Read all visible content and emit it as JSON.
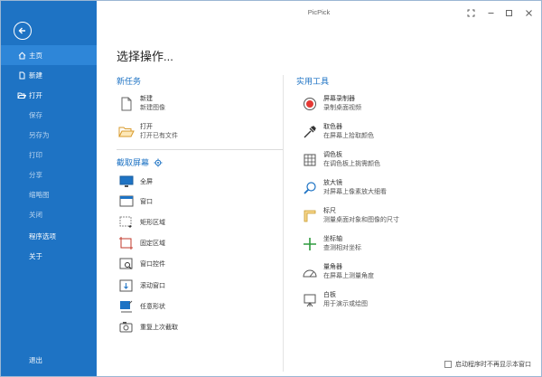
{
  "window": {
    "title": "PicPick"
  },
  "sidebar": {
    "items": [
      {
        "label": "主页",
        "icon": "home-icon",
        "active": true
      },
      {
        "label": "新建",
        "icon": "new-file-icon"
      },
      {
        "label": "打开",
        "icon": "open-folder-icon"
      },
      {
        "label": "保存"
      },
      {
        "label": "另存为"
      },
      {
        "label": "打印"
      },
      {
        "label": "分享"
      },
      {
        "label": "缩略图"
      },
      {
        "label": "关闭"
      },
      {
        "label": "程序选项"
      },
      {
        "label": "关于"
      }
    ],
    "exit_label": "退出"
  },
  "main": {
    "heading": "选择操作...",
    "new_task": {
      "title": "新任务",
      "items": [
        {
          "line1": "新建",
          "line2": "新建图像"
        },
        {
          "line1": "打开",
          "line2": "打开已有文件"
        }
      ]
    },
    "capture": {
      "title": "截取屏幕",
      "items": [
        "全屏",
        "窗口",
        "矩形区域",
        "固定区域",
        "窗口控件",
        "滚动窗口",
        "任意形状",
        "重复上次截取"
      ]
    },
    "tools": {
      "title": "实用工具",
      "items": [
        {
          "line1": "屏幕录制器",
          "line2": "录制桌面视频"
        },
        {
          "line1": "取色器",
          "line2": "在屏幕上拾取颜色"
        },
        {
          "line1": "调色板",
          "line2": "在调色板上挑需颜色"
        },
        {
          "line1": "放大镜",
          "line2": "对屏幕上像素放大细看"
        },
        {
          "line1": "标尺",
          "line2": "测量桌面对象和图像的尺寸"
        },
        {
          "line1": "坐标轴",
          "line2": "查测相对坐标"
        },
        {
          "line1": "量角器",
          "line2": "在屏幕上测量角度"
        },
        {
          "line1": "白板",
          "line2": "用于演示或绘图"
        }
      ]
    }
  },
  "footer": {
    "checkbox_label": "启动程序时不再显示本窗口"
  },
  "colors": {
    "sidebar": "#1e73c4",
    "active": "#2e86d8",
    "accent": "#1e73c4"
  }
}
